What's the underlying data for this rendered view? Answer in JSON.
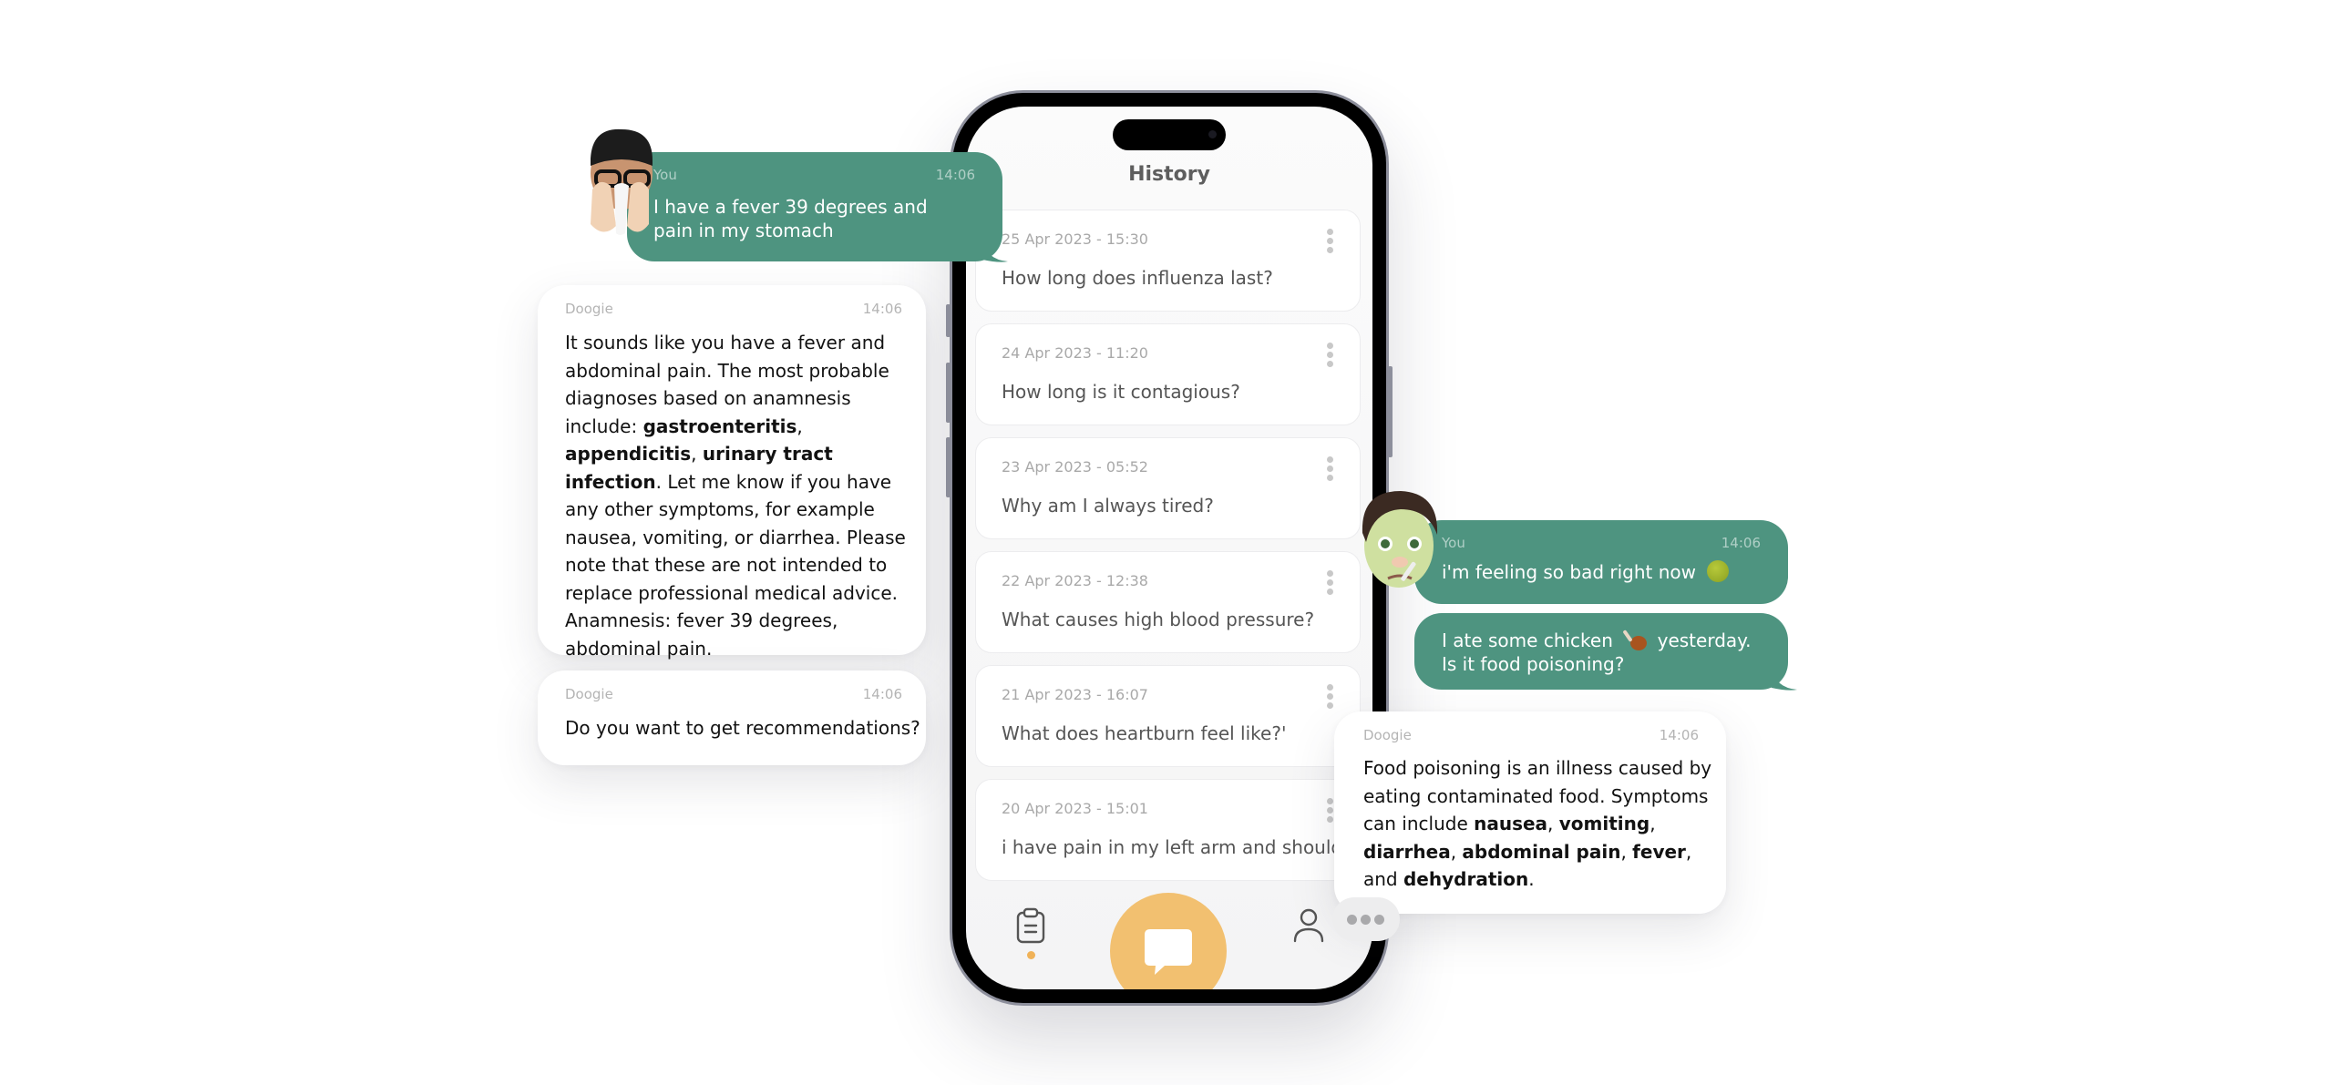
{
  "screen": {
    "title": "History",
    "history": [
      {
        "date": "25 Apr 2023 - 15:30",
        "question": "How long does influenza last?"
      },
      {
        "date": "24 Apr 2023 - 11:20",
        "question": "How long is it contagious?"
      },
      {
        "date": "23 Apr 2023 - 05:52",
        "question": "Why am I always tired?"
      },
      {
        "date": "22 Apr 2023 - 12:38",
        "question": "What causes high blood pressure?"
      },
      {
        "date": "21 Apr 2023 - 16:07",
        "question": "What does heartburn feel like?'"
      },
      {
        "date": "20 Apr 2023 - 15:01",
        "question": "i have pain in my left arm and shoulder"
      }
    ],
    "tabbar": {
      "items": [
        {
          "icon": "clipboard-icon",
          "label": "History",
          "active": true
        },
        {
          "icon": "chat-bubble-icon",
          "label": "Chat"
        },
        {
          "icon": "user-profile-icon",
          "label": "Profile"
        }
      ],
      "accent": "#f2c070"
    }
  },
  "colors": {
    "user_bubble": "#4e9480",
    "bot_bubble": "#ffffff",
    "accent": "#f2c070"
  },
  "chat_left": {
    "user_message": {
      "sender": "You",
      "time": "14:06",
      "text": "I have a fever 39 degrees and pain in my stomach",
      "avatar": "sneezing-memoji-avatar"
    },
    "bot_message_1": {
      "sender": "Doogie",
      "time": "14:06",
      "parts": [
        {
          "t": "It sounds like you have a fever and abdominal pain. The most probable diagnoses based on anamnesis include: ",
          "b": false
        },
        {
          "t": "gastroenteritis",
          "b": true
        },
        {
          "t": ", ",
          "b": false
        },
        {
          "t": "appendicitis",
          "b": true
        },
        {
          "t": ", ",
          "b": false
        },
        {
          "t": "urinary tract infection",
          "b": true
        },
        {
          "t": ". Let me know if you have any other symptoms, for example nausea, vomiting, or diarrhea. Please note that these are not intended to replace professional medical advice. Anamnesis: fever 39 degrees, abdominal pain.",
          "b": false
        }
      ]
    },
    "bot_message_2": {
      "sender": "Doogie",
      "time": "14:06",
      "text": "Do you want to get recommendations?"
    }
  },
  "chat_right": {
    "user_message_1": {
      "sender": "You",
      "time": "14:06",
      "text": "i'm feeling so bad right now",
      "emoji": "nauseated-face",
      "avatar": "sick-memoji-avatar"
    },
    "user_message_2": {
      "text_before": "I ate some chicken",
      "emoji": "poultry-leg",
      "text_after": "yesterday. Is it food poisoning?"
    },
    "bot_message": {
      "sender": "Doogie",
      "time": "14:06",
      "parts": [
        {
          "t": "Food poisoning is an illness caused by eating contaminated food. Symptoms can include ",
          "b": false
        },
        {
          "t": "nausea",
          "b": true
        },
        {
          "t": ", ",
          "b": false
        },
        {
          "t": "vomiting",
          "b": true
        },
        {
          "t": ", ",
          "b": false
        },
        {
          "t": "diarrhea",
          "b": true
        },
        {
          "t": ", ",
          "b": false
        },
        {
          "t": "abdominal pain",
          "b": true
        },
        {
          "t": ", ",
          "b": false
        },
        {
          "t": "fever",
          "b": true
        },
        {
          "t": ", and ",
          "b": false
        },
        {
          "t": "dehydration",
          "b": true
        },
        {
          "t": ".",
          "b": false
        }
      ]
    },
    "typing_indicator": "typing-dots"
  }
}
